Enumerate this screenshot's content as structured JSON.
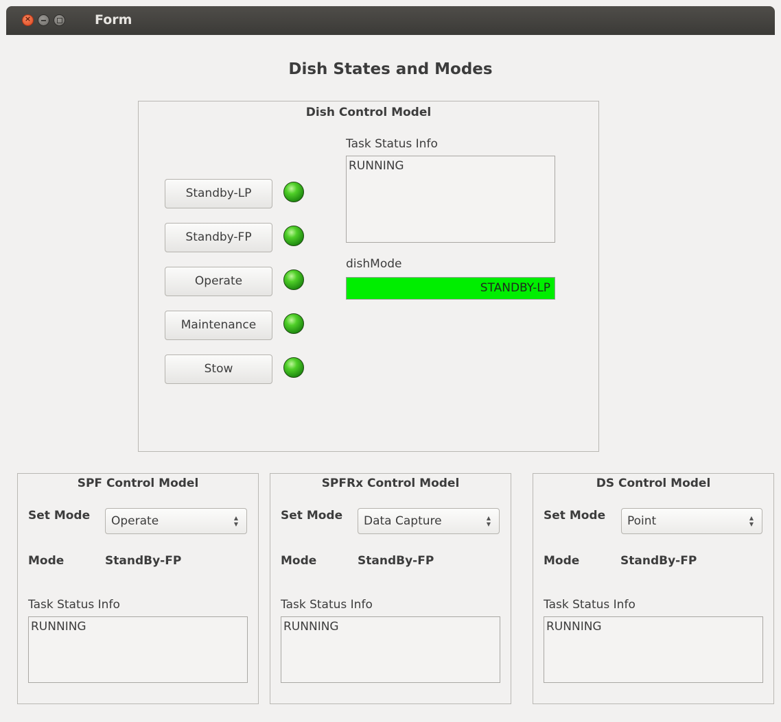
{
  "window": {
    "title": "Form"
  },
  "heading": "Dish States and Modes",
  "dish": {
    "title": "Dish Control Model",
    "buttons": [
      "Standby-LP",
      "Standby-FP",
      "Operate",
      "Maintenance",
      "Stow"
    ],
    "task_status_label": "Task Status Info",
    "task_status_value": "RUNNING",
    "dishmode_label": "dishMode",
    "dishmode_value": "STANDBY-LP",
    "dishmode_color": "#00ee00",
    "led_color": "#2fb318"
  },
  "spf": {
    "title": "SPF Control Model",
    "set_mode_label": "Set Mode",
    "set_mode_value": "Operate",
    "mode_label": "Mode",
    "mode_value": "StandBy-FP",
    "task_status_label": "Task Status Info",
    "task_status_value": "RUNNING"
  },
  "spfrx": {
    "title": "SPFRx Control Model",
    "set_mode_label": "Set Mode",
    "set_mode_value": "Data Capture",
    "mode_label": "Mode",
    "mode_value": "StandBy-FP",
    "task_status_label": "Task Status Info",
    "task_status_value": "RUNNING"
  },
  "ds": {
    "title": "DS Control Model",
    "set_mode_label": "Set Mode",
    "set_mode_value": "Point",
    "mode_label": "Mode",
    "mode_value": "StandBy-FP",
    "task_status_label": "Task Status Info",
    "task_status_value": "RUNNING"
  }
}
